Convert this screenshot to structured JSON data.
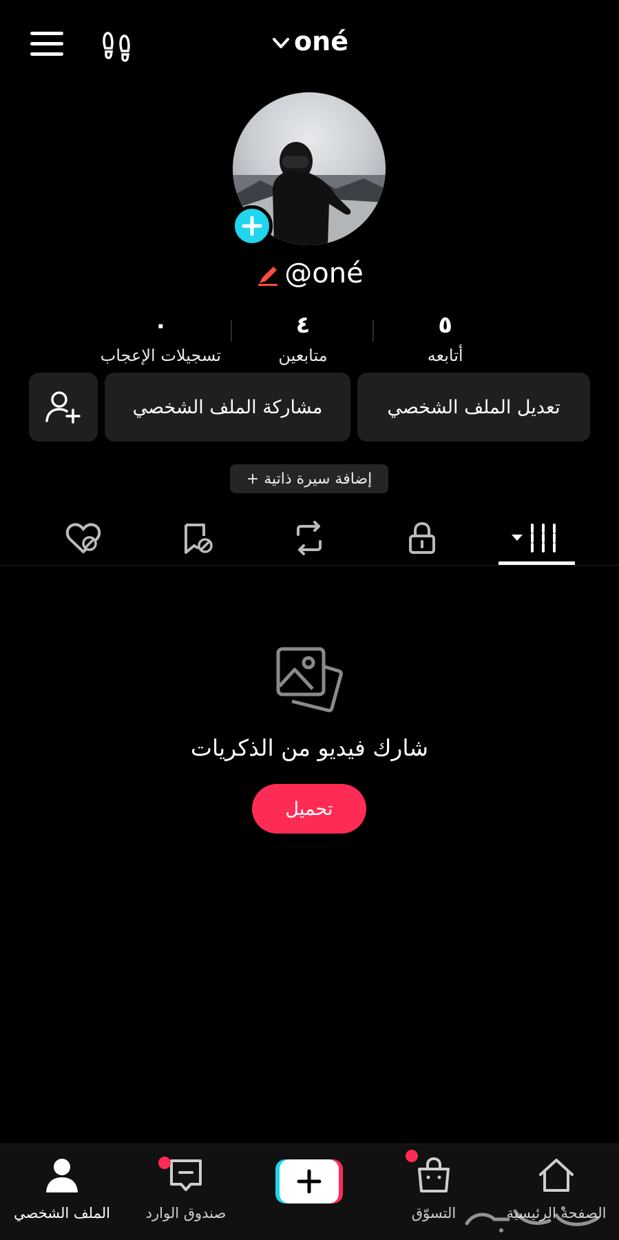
{
  "header": {
    "account_name": "oné"
  },
  "profile": {
    "username": "@oné",
    "stats": [
      {
        "value": "٥",
        "label": "أتابعه"
      },
      {
        "value": "٤",
        "label": "متابعين"
      },
      {
        "value": "٠",
        "label": "تسجيلات الإعجاب"
      }
    ],
    "edit_label": "تعديل الملف الشخصي",
    "share_label": "مشاركة الملف الشخصي",
    "bio_label": "+ إضافة سيرة ذاتية"
  },
  "tabs": [
    "videos-grid",
    "private",
    "reposts",
    "favorites",
    "liked"
  ],
  "empty_state": {
    "text": "شارك فيديو من الذكريات",
    "upload_label": "تحميل"
  },
  "bottom_nav": [
    {
      "label": "الملف الشخصي",
      "icon": "person-icon",
      "active": true
    },
    {
      "label": "صندوق الوارد",
      "icon": "inbox-icon",
      "badge": true
    },
    {
      "label": "",
      "icon": "create-icon"
    },
    {
      "label": "التسوّق",
      "icon": "shop-icon",
      "badge": true
    },
    {
      "label": "الصفحة الرئيسية",
      "icon": "home-icon"
    }
  ],
  "colors": {
    "accent": "#fe2c55",
    "cyan": "#20d5ec",
    "button_bg": "#1f1f1f"
  }
}
